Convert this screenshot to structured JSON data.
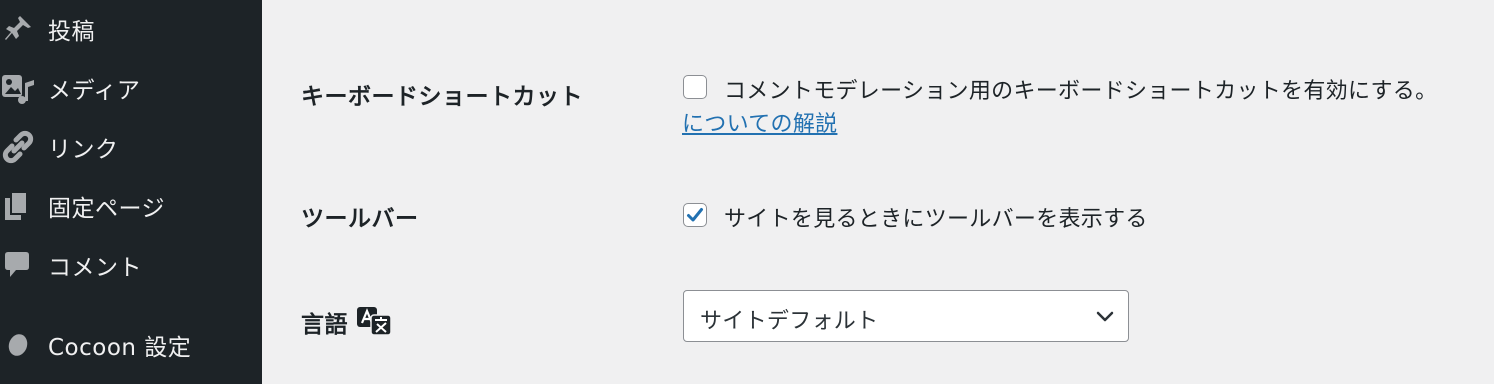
{
  "sidebar": {
    "items": [
      {
        "label": "投稿",
        "icon": "pin-icon"
      },
      {
        "label": "メディア",
        "icon": "media-icon"
      },
      {
        "label": "リンク",
        "icon": "link-icon"
      },
      {
        "label": "固定ページ",
        "icon": "pages-icon"
      },
      {
        "label": "コメント",
        "icon": "comment-icon"
      },
      {
        "label": "Cocoon 設定",
        "icon": "cocoon-icon"
      }
    ]
  },
  "settings": {
    "keyboard_shortcuts": {
      "label": "キーボードショートカット",
      "checkbox_text": "コメントモデレーション用のキーボードショートカットを有効にする。",
      "checked": false,
      "help_link": "についての解説"
    },
    "toolbar": {
      "label": "ツールバー",
      "checkbox_text": "サイトを見るときにツールバーを表示する",
      "checked": true
    },
    "language": {
      "label": "言語",
      "icon": "translate-icon",
      "selected": "サイトデフォルト"
    }
  },
  "colors": {
    "sidebar_bg": "#1d2327",
    "content_bg": "#f0f0f1",
    "link": "#2271b1",
    "checkmark": "#2271b1"
  }
}
